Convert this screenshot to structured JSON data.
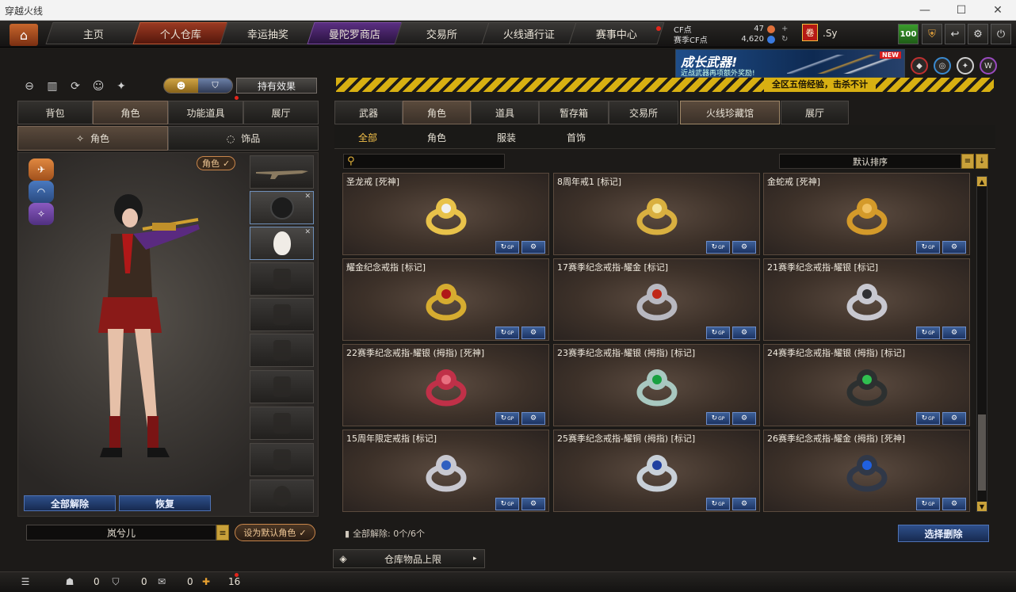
{
  "window": {
    "title": "穿越火线"
  },
  "nav": {
    "tabs": [
      {
        "label": "主页"
      },
      {
        "label": "个人仓库"
      },
      {
        "label": "幸运抽奖"
      },
      {
        "label": "曼陀罗商店"
      },
      {
        "label": "交易所"
      },
      {
        "label": "火线通行证"
      },
      {
        "label": "赛事中心"
      }
    ]
  },
  "currency": {
    "cf_label": "CF点",
    "cf_value": "47",
    "match_label": "赛季CF点",
    "match_value": "4,620"
  },
  "player": {
    "badge": "卷",
    "name": ".Sy",
    "level": "100"
  },
  "banner": {
    "title": "成长武器!",
    "subtitle": "近战武器再项额外奖励!",
    "new_tag": "NEW"
  },
  "ticker": {
    "text": "全区五倍经验，击杀不计"
  },
  "left": {
    "effects_button": "持有效果",
    "tabs": [
      "背包",
      "角色",
      "功能道具",
      "展厅"
    ],
    "subtabs": [
      "角色",
      "饰品"
    ],
    "role_pill": "角色",
    "reset_all": "全部解除",
    "restore": "恢复",
    "character_name": "岚兮儿",
    "set_default": "设为默认角色"
  },
  "right": {
    "tabs": [
      "武器",
      "角色",
      "道具",
      "暂存箱",
      "交易所",
      "火线珍藏馆",
      "展厅"
    ],
    "subtabs": [
      "全部",
      "角色",
      "服装",
      "首饰"
    ],
    "search_placeholder": "",
    "sort_label": "默认排序",
    "bottom_info": "全部解除:  0个/6个",
    "select_delete": "选择删除",
    "warehouse_limit": "仓库物品上限"
  },
  "items": [
    {
      "title": "圣龙戒 [死神]",
      "color": "#e8c24a",
      "accent": "#f0f0f0"
    },
    {
      "title": "8周年戒1 [标记]",
      "color": "#d9b040",
      "accent": "#f5e6a0"
    },
    {
      "title": "金蛇戒 [死神]",
      "color": "#d49a2a",
      "accent": "#f0c060"
    },
    {
      "title": "耀金纪念戒指 [标记]",
      "color": "#d6ac30",
      "accent": "#b01818"
    },
    {
      "title": "17赛季纪念戒指-耀金 [标记]",
      "color": "#b8b8c0",
      "accent": "#c02818"
    },
    {
      "title": "21赛季纪念戒指-耀银 [标记]",
      "color": "#c8c8d0",
      "accent": "#303034"
    },
    {
      "title": "22赛季纪念戒指-耀银 (拇指) [死神]",
      "color": "#c03048",
      "accent": "#e87080"
    },
    {
      "title": "23赛季纪念戒指-耀银 (拇指) [标记]",
      "color": "#a8c8c0",
      "accent": "#18a040"
    },
    {
      "title": "24赛季纪念戒指-耀银 (拇指) [标记]",
      "color": "#2c3030",
      "accent": "#30c050"
    },
    {
      "title": "15周年限定戒指 [标记]",
      "color": "#c8c8d0",
      "accent": "#3060c0"
    },
    {
      "title": "25赛季纪念戒指-耀铜 (拇指) [标记]",
      "color": "#c8d0d8",
      "accent": "#2040a0"
    },
    {
      "title": "26赛季纪念戒指-耀金 (拇指) [死神]",
      "color": "#303848",
      "accent": "#2060e0"
    }
  ],
  "card_buttons": {
    "gp": "GP"
  },
  "status": {
    "count1": "0",
    "count2": "0",
    "count3": "0",
    "count4": "16"
  }
}
